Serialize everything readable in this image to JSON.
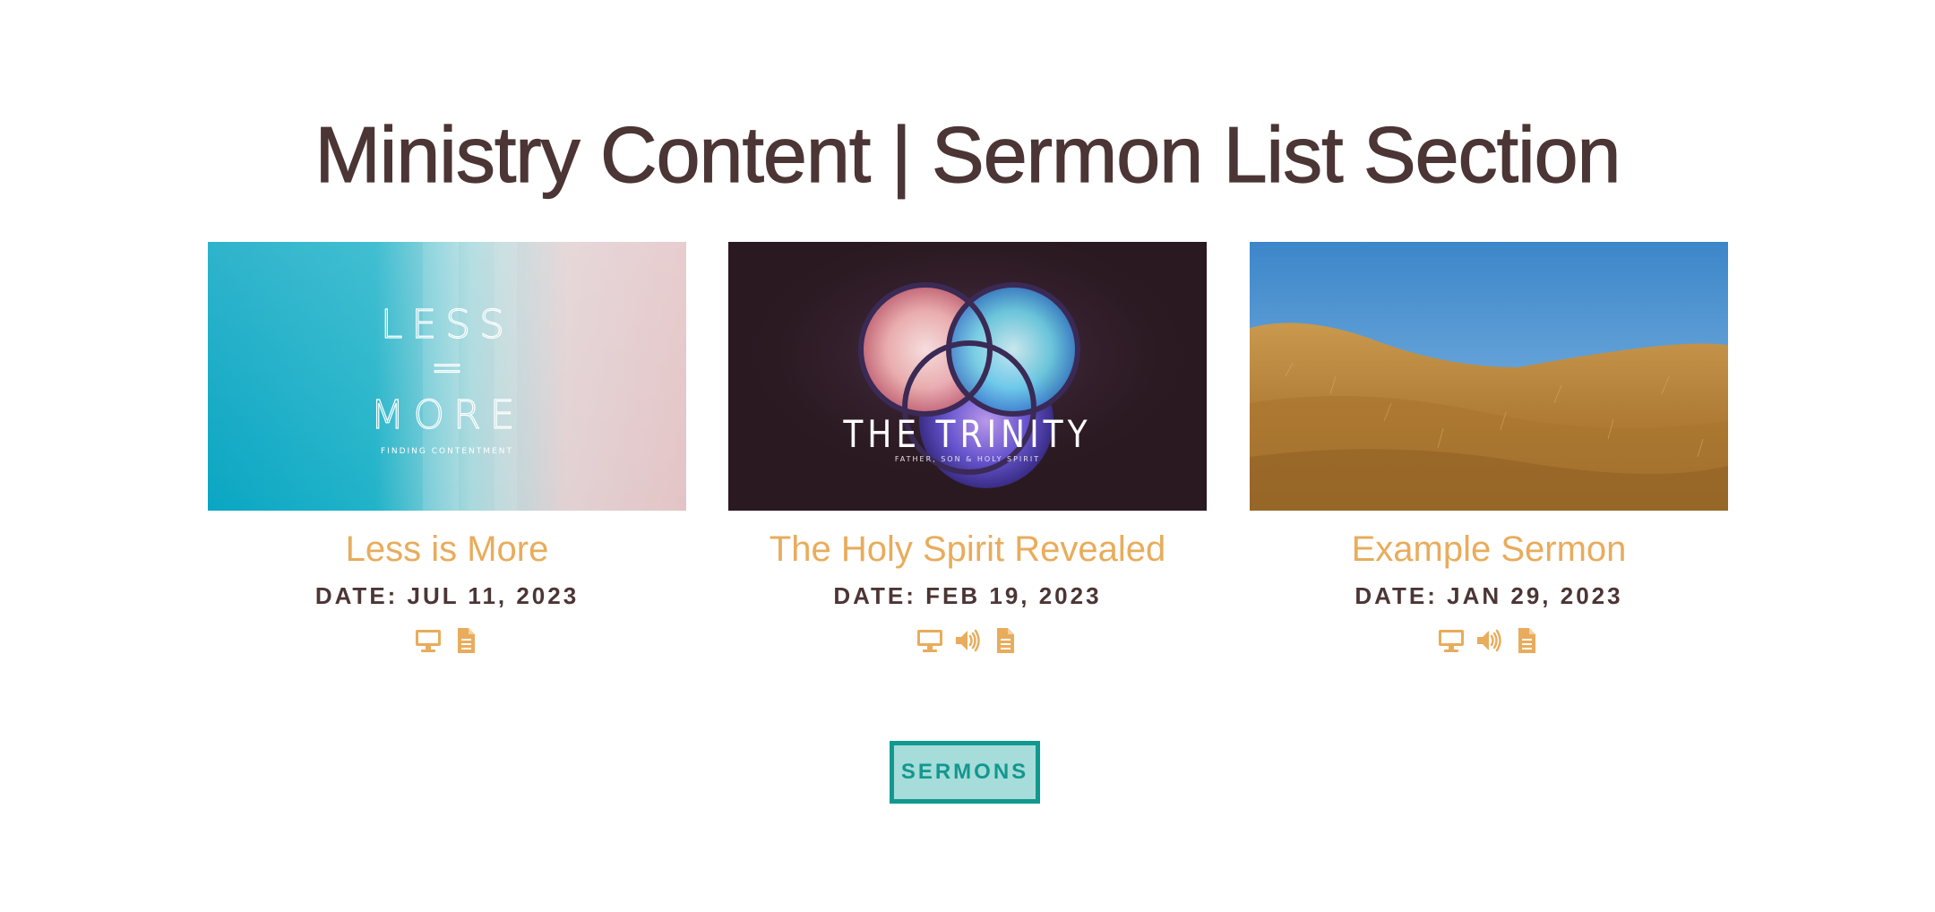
{
  "section": {
    "title": "Ministry Content | Sermon List Section"
  },
  "sermons": [
    {
      "title": "Less is More",
      "date": "DATE: JUL 11, 2023",
      "thumbnail": {
        "lines": [
          "LESS",
          "=",
          "MORE"
        ],
        "subtitle": "FINDING CONTENTMENT"
      },
      "media_icons": [
        "video-icon",
        "document-icon"
      ]
    },
    {
      "title": "The Holy Spirit Revealed",
      "date": "DATE: FEB 19, 2023",
      "thumbnail": {
        "heading": "THE TRINITY",
        "subtitle": "FATHER, SON & HOLY SPIRIT"
      },
      "media_icons": [
        "video-icon",
        "audio-icon",
        "document-icon"
      ]
    },
    {
      "title": "Example Sermon",
      "date": "DATE: JAN 29, 2023",
      "thumbnail": {},
      "media_icons": [
        "video-icon",
        "audio-icon",
        "document-icon"
      ]
    }
  ],
  "button": {
    "label": "SERMONS"
  },
  "colors": {
    "title": "#4c3535",
    "accent": "#e8ac5c",
    "button_border": "#11988f",
    "button_fill": "#a6dcd9"
  }
}
